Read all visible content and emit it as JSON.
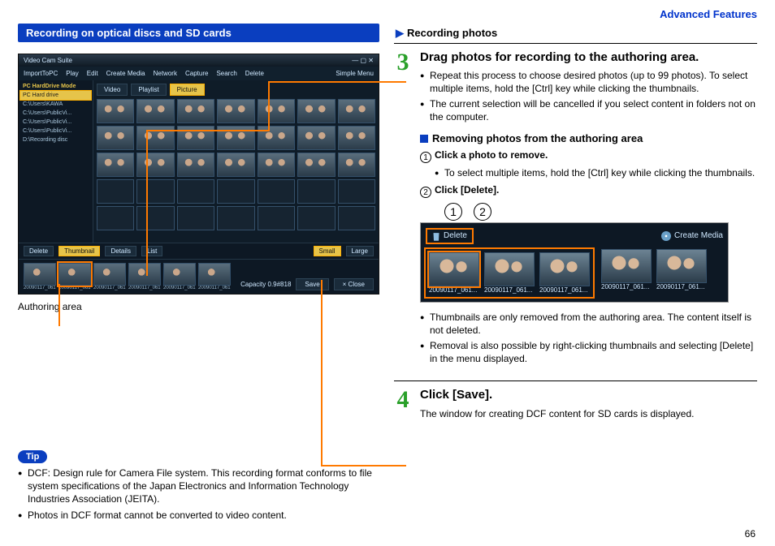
{
  "header": {
    "advanced": "Advanced Features"
  },
  "left": {
    "title": "Recording on optical discs and SD cards",
    "app": {
      "title": "Video Cam Suite",
      "toolbar": [
        "ImportToPC",
        "Play",
        "Edit",
        "Create Media",
        "Network",
        "Capture",
        "Search",
        "Delete"
      ],
      "settings_mode": "Simple Menu",
      "sidebar_header": "PC HardDrive Mode",
      "sidebar": [
        "PC Hard drive",
        "C:\\Users\\KAWA",
        "C:\\Users\\PublicVi...",
        "C:\\Users\\PublicVi...",
        "C:\\Users\\PublicVi...",
        "D:\\Recording disc"
      ],
      "tabs": [
        "Video",
        "Playlist",
        "Picture"
      ],
      "toolbar2_left": [
        "Delete",
        "Thumbnail",
        "Details",
        "List"
      ],
      "toolbar2_right": [
        "Small",
        "Large"
      ],
      "capacity": "Capacity   0.9#818",
      "save": "Save",
      "close": "× Close",
      "thumb_label": "20090117_061..."
    },
    "authoring_label": "Authoring area",
    "tip_label": "Tip",
    "tips": [
      "DCF: Design rule for Camera File system. This recording format conforms to file system specifications of the Japan Electronics and Information Technology Industries Association (JEITA).",
      "Photos in DCF format cannot be converted to video content."
    ]
  },
  "right": {
    "subheader": "Recording photos",
    "step3": {
      "num": "3",
      "title": "Drag photos for recording to the authoring area.",
      "bullets": [
        "Repeat this process to choose desired photos (up to 99 photos). To select multiple items, hold the [Ctrl] key while clicking the thumbnails.",
        "The current selection will be cancelled if you select content in folders not on the computer."
      ],
      "removing_h": "Removing photos from the authoring area",
      "sub1_label": "Click a photo to remove.",
      "sub1_bullet": "To select multiple items, hold the [Ctrl] key while clicking the thumbnails.",
      "sub2_label": "Click [Delete].",
      "circ1": "1",
      "circ2": "2",
      "inset": {
        "delete": "Delete",
        "create": "Create Media",
        "thumb_label": "20090117_061..."
      },
      "after_bullets": [
        "Thumbnails are only removed from the authoring area. The content itself is not deleted.",
        "Removal is also possible by right-clicking thumbnails and selecting [Delete] in the menu displayed."
      ]
    },
    "step4": {
      "num": "4",
      "title": "Click [Save].",
      "body": "The window for creating DCF content for SD cards is displayed."
    }
  },
  "pagenum": "66"
}
